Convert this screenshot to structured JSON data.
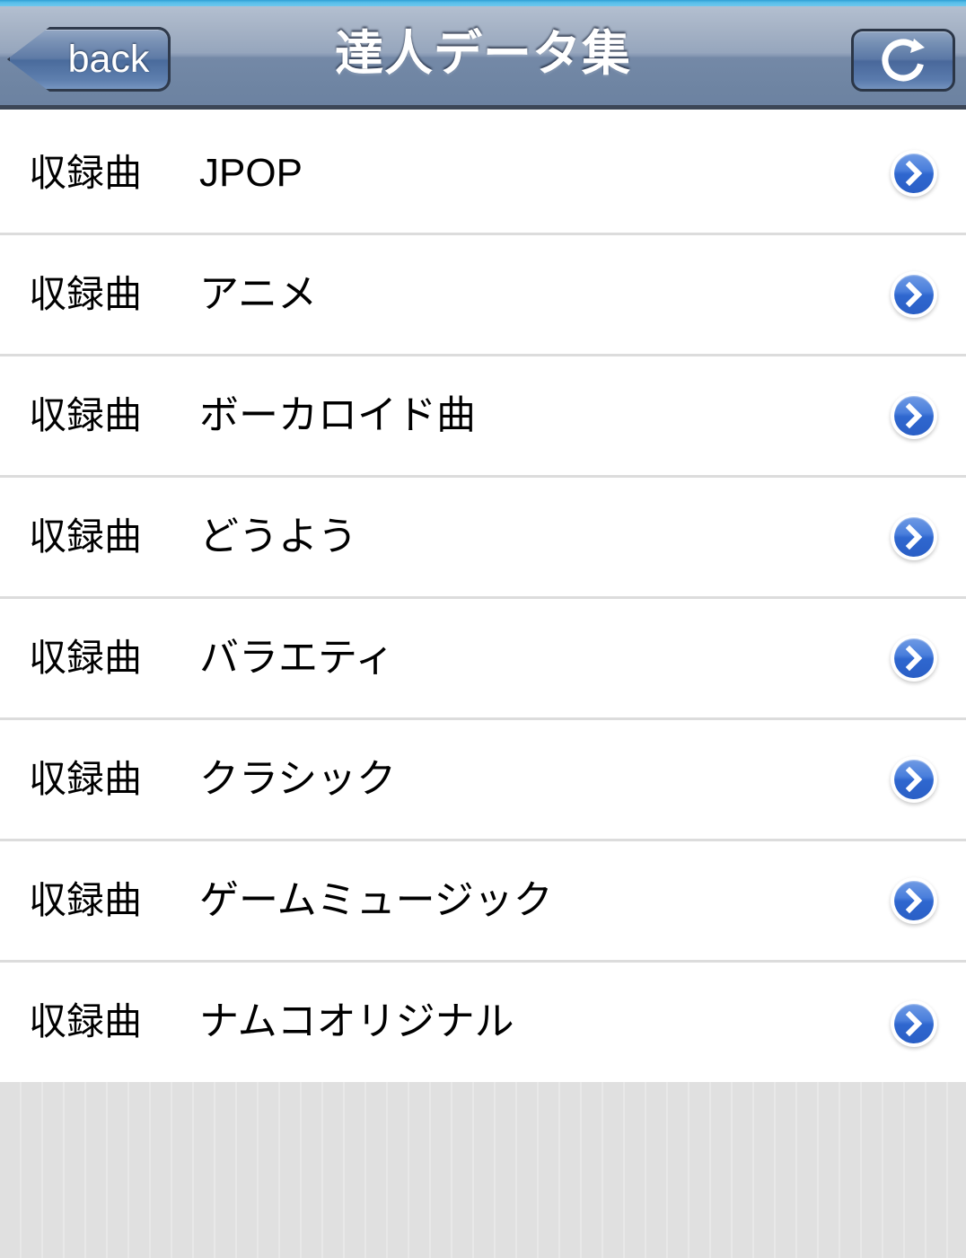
{
  "status_bar": {
    "accent_color": "#57bde9"
  },
  "navbar": {
    "title": "達人データ集",
    "back_label": "back",
    "back_icon": "chevron-left-icon",
    "refresh_icon": "refresh-icon",
    "background_top_color": "#b3bfd0",
    "background_bottom_color": "#6c82a1",
    "border_color": "#3c4656"
  },
  "list": {
    "rows": [
      {
        "kind": "収録曲",
        "title": "JPOP",
        "chevron_icon": "chevron-right-icon"
      },
      {
        "kind": "収録曲",
        "title": "アニメ",
        "chevron_icon": "chevron-right-icon"
      },
      {
        "kind": "収録曲",
        "title": "ボーカロイド曲",
        "chevron_icon": "chevron-right-icon"
      },
      {
        "kind": "収録曲",
        "title": "どうよう",
        "chevron_icon": "chevron-right-icon"
      },
      {
        "kind": "収録曲",
        "title": "バラエティ",
        "chevron_icon": "chevron-right-icon"
      },
      {
        "kind": "収録曲",
        "title": "クラシック",
        "chevron_icon": "chevron-right-icon"
      },
      {
        "kind": "収録曲",
        "title": "ゲームミュージック",
        "chevron_icon": "chevron-right-icon"
      },
      {
        "kind": "収録曲",
        "title": "ナムコオリジナル",
        "chevron_icon": "chevron-right-icon"
      }
    ],
    "separator_color": "#dcdcdc",
    "row_background": "#ffffff",
    "accent_color": "#2f67cf"
  },
  "footer": {
    "background_color": "#e0e0e0"
  }
}
